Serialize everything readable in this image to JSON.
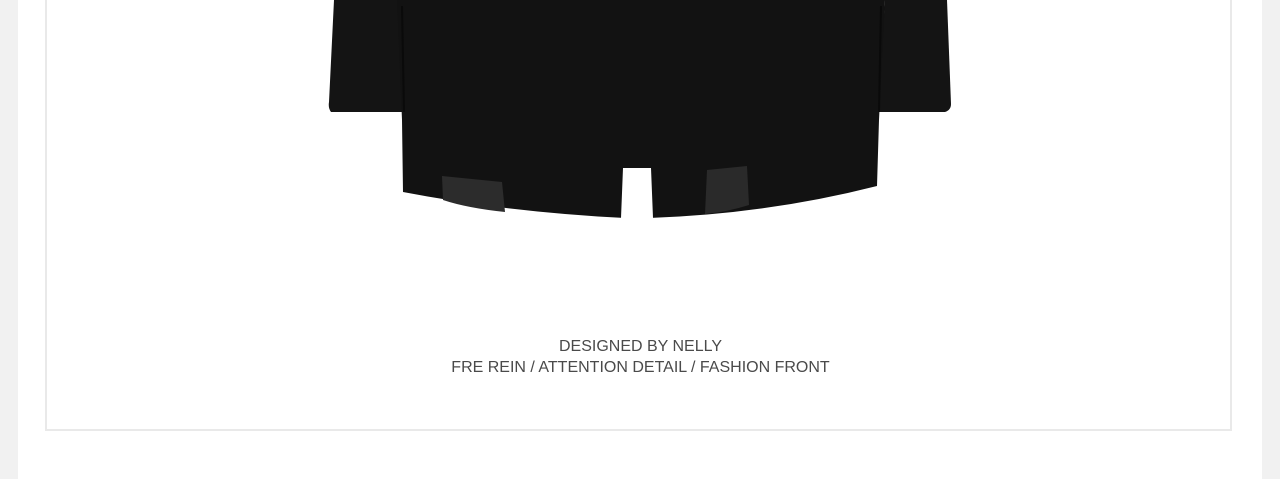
{
  "caption": {
    "line1": "DESIGNED BY NELLY",
    "line2": "FRE REIN / ATTENTION DETAIL / FASHION FRONT"
  },
  "product_image": {
    "icon": "black-jacket-back-icon",
    "colors": {
      "garment": "#111111",
      "lining": "#2a2a2a",
      "background": "#ffffff"
    }
  }
}
